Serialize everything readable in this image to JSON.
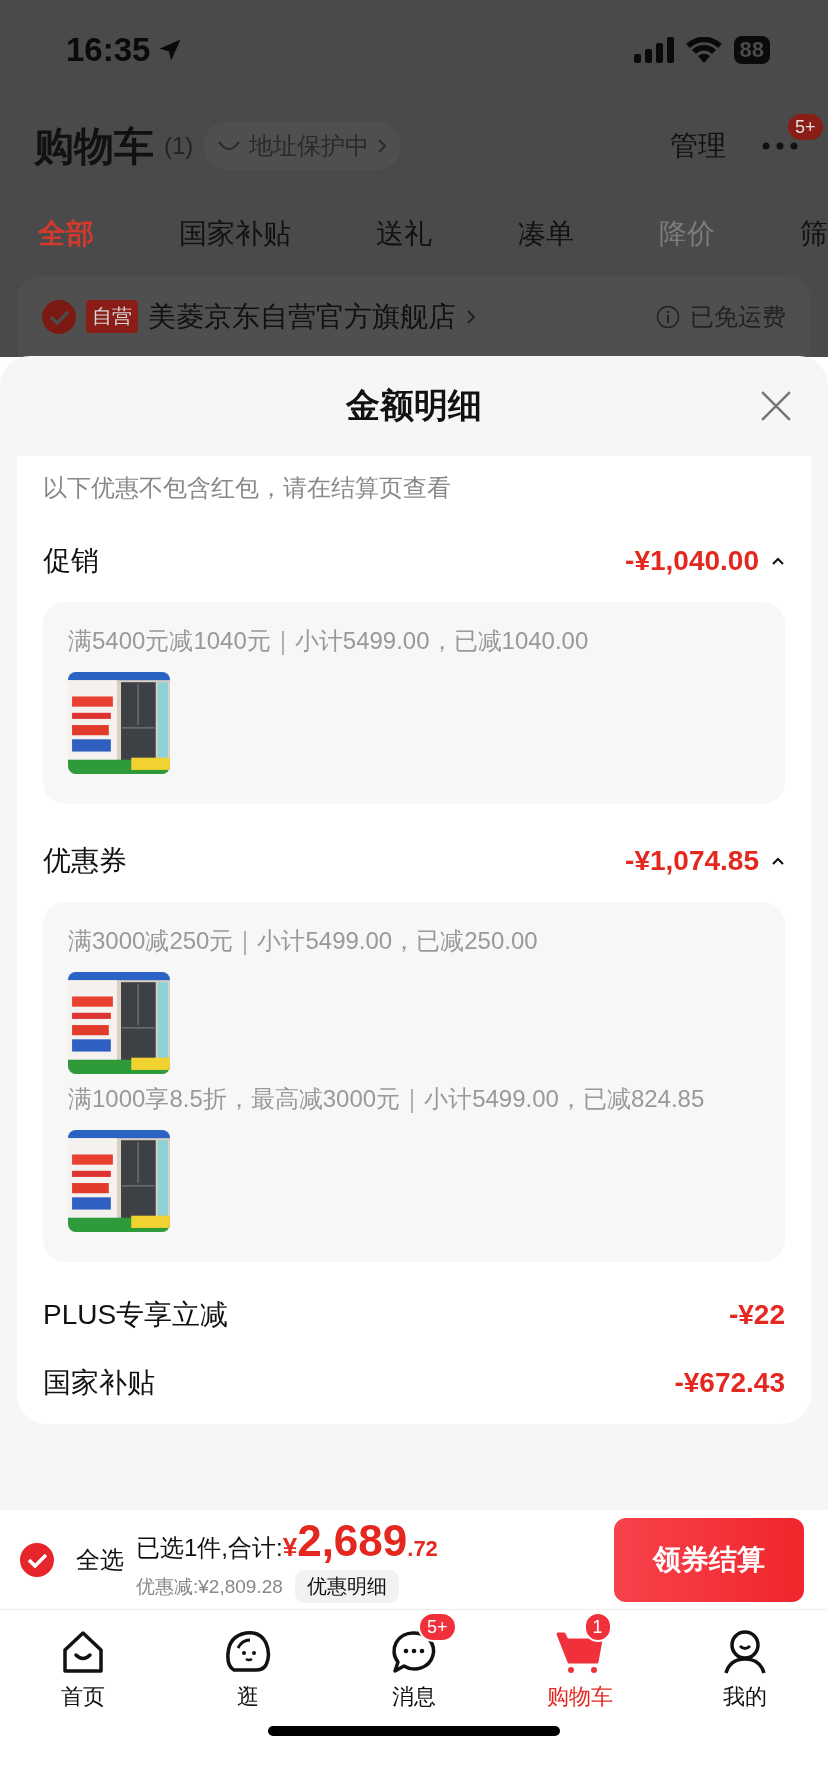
{
  "status_bar": {
    "time": "16:35",
    "battery": "88"
  },
  "header": {
    "title": "购物车",
    "count": "(1)",
    "address_pill": "地址保护中",
    "manage": "管理",
    "more_badge": "5+"
  },
  "tabs": [
    {
      "label": "全部",
      "selected": true,
      "disabled": false
    },
    {
      "label": "国家补贴",
      "selected": false,
      "disabled": false
    },
    {
      "label": "送礼",
      "selected": false,
      "disabled": false
    },
    {
      "label": "凑单",
      "selected": false,
      "disabled": false
    },
    {
      "label": "降价",
      "selected": false,
      "disabled": true
    },
    {
      "label": "筛",
      "selected": false,
      "disabled": false
    }
  ],
  "store": {
    "checked": true,
    "badge": "自营",
    "name": "美菱京东自营官方旗舰店",
    "shipping": "已免运费"
  },
  "sheet": {
    "title": "金额明细",
    "note": "以下优惠不包含红包，请在结算页查看",
    "sections": [
      {
        "kind": "group",
        "label": "促销",
        "amount": "-¥1,040.00",
        "expanded": true,
        "rules": [
          {
            "text": "满5400元减1040元｜小计5499.00，已减1040.00"
          }
        ]
      },
      {
        "kind": "group",
        "label": "优惠券",
        "amount": "-¥1,074.85",
        "expanded": true,
        "rules": [
          {
            "text": "满3000减250元｜小计5499.00，已减250.00"
          },
          {
            "text": "满1000享8.5折，最高减3000元｜小计5499.00，已减824.85"
          }
        ]
      },
      {
        "kind": "line",
        "label": "PLUS专享立减",
        "amount": "-¥22"
      },
      {
        "kind": "line",
        "label": "国家补贴",
        "amount": "-¥672.43"
      }
    ]
  },
  "footer": {
    "select_all": {
      "label": "全选",
      "checked": true
    },
    "summary": "已选1件,合计:",
    "currency": "¥",
    "amount_int": "2,689",
    "amount_dec": ".72",
    "discount": "优惠减:¥2,809.28",
    "details_chip": "优惠明细",
    "checkout": "领券结算"
  },
  "tabbar": [
    {
      "kind": "home",
      "label": "首页",
      "selected": false
    },
    {
      "kind": "browse",
      "label": "逛",
      "selected": false
    },
    {
      "kind": "messages",
      "label": "消息",
      "selected": false,
      "badge": "5+"
    },
    {
      "kind": "cart",
      "label": "购物车",
      "selected": true,
      "badge": "1"
    },
    {
      "kind": "profile",
      "label": "我的",
      "selected": false
    }
  ]
}
